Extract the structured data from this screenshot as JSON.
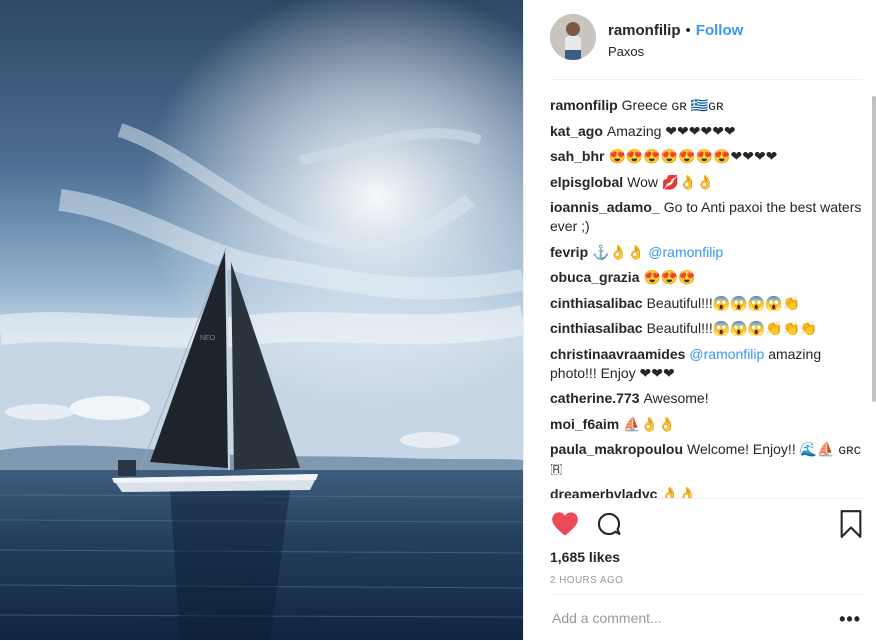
{
  "post": {
    "username": "ramonfilip",
    "separator": "•",
    "follow_label": "Follow",
    "location": "Paxos",
    "likes": "1,685 likes",
    "timestamp": "2 HOURS AGO",
    "add_comment_placeholder": "Add a comment...",
    "more_label": "•••"
  },
  "comments": [
    {
      "user": "ramonfilip",
      "text": "Greece ɢʀ 🇬🇷ɢʀ"
    },
    {
      "user": "kat_ago",
      "text": "Amazing ❤❤❤❤❤❤"
    },
    {
      "user": "sah_bhr",
      "text": "😍😍😍😍😍😍😍❤❤❤❤"
    },
    {
      "user": "elpisglobal",
      "text": "Wow 💋👌👌"
    },
    {
      "user": "ioannis_adamo_",
      "text": "Go to Anti paxoi the best waters ever ;)"
    },
    {
      "user": "fevrip",
      "text": "⚓👌👌 ",
      "mention": "@ramonfilip"
    },
    {
      "user": "obuca_grazia",
      "text": "😍😍😍"
    },
    {
      "user": "cinthiasalibac",
      "text": "Beautiful!!!😱😱😱😱👏"
    },
    {
      "user": "cinthiasalibac",
      "text": "Beautiful!!!😱😱😱👏👏👏"
    },
    {
      "user": "christinaavraamides",
      "mention": "@ramonfilip",
      "text_after": " amazing photo!!! Enjoy ❤❤❤"
    },
    {
      "user": "catherine.773",
      "text": "Awesome!"
    },
    {
      "user": "moi_f6aim",
      "text": "⛵👌👌"
    },
    {
      "user": "paula_makropoulou",
      "text": "Welcome! Enjoy!! 🌊⛵ ɢʀᴄ🇷"
    },
    {
      "user": "dreamerbyladyc",
      "text": "👌👌"
    }
  ],
  "icons": {
    "like": "heart-filled-icon",
    "comment": "speech-bubble-icon",
    "save": "bookmark-icon",
    "more": "ellipsis-icon"
  },
  "colors": {
    "like": "#ed4956",
    "link": "#3897f0",
    "text": "#262626",
    "muted": "#999999",
    "border": "#efefef"
  }
}
